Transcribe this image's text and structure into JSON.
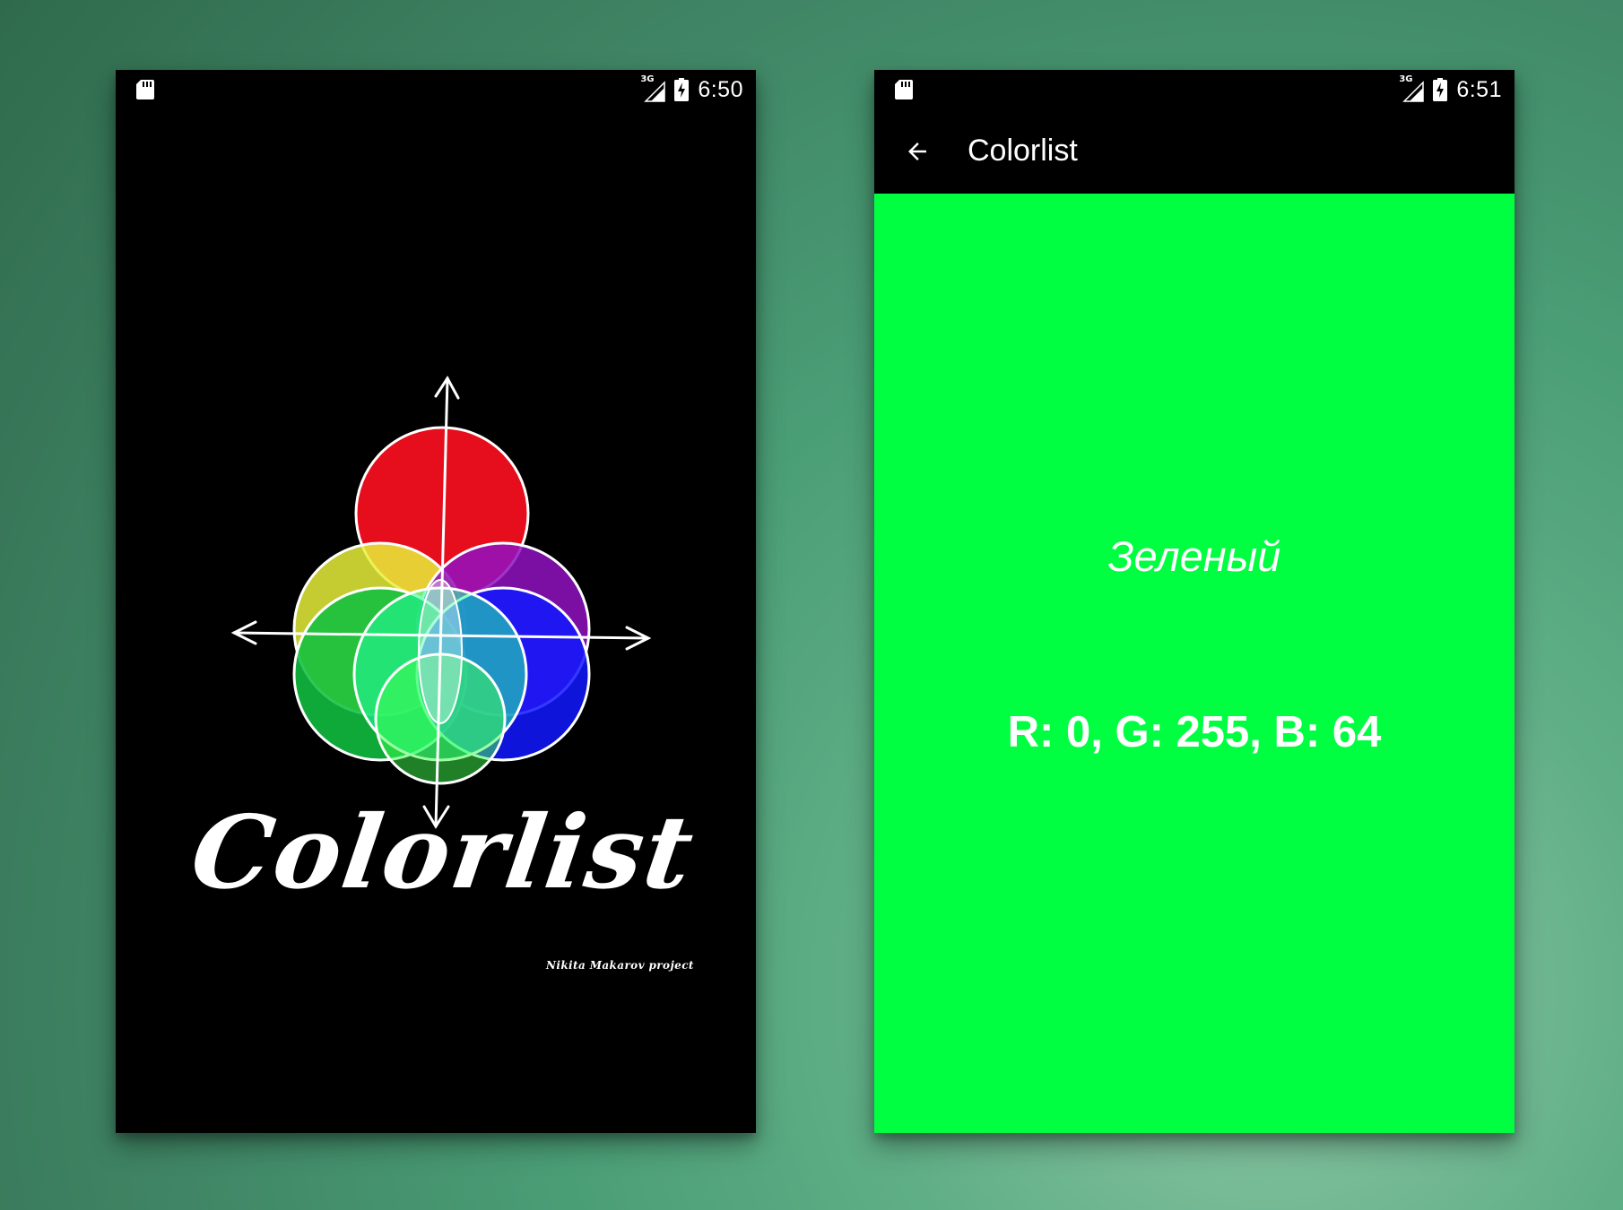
{
  "splash_screen": {
    "status_bar": {
      "time": "6:50",
      "network": "3G",
      "icons": [
        "sd-card-icon",
        "signal-icon",
        "battery-charging-icon"
      ]
    },
    "logo": {
      "wordmark": "Colorlist",
      "credit": "Nikita Makarov project",
      "circle_colors": [
        "#ff1018",
        "#e8f03a",
        "#9010c0",
        "#10c040",
        "#1018ff"
      ]
    }
  },
  "detail_screen": {
    "status_bar": {
      "time": "6:51",
      "network": "3G",
      "icons": [
        "sd-card-icon",
        "signal-icon",
        "battery-charging-icon"
      ]
    },
    "app_bar": {
      "back_icon": "arrow-back-icon",
      "title": "Colorlist"
    },
    "color": {
      "name": "Зеленый",
      "rgb_text": "R: 0, G: 255, B: 64",
      "hex": "#00ff40"
    }
  }
}
